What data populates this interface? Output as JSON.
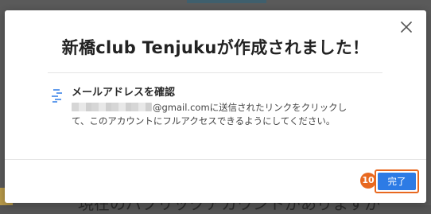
{
  "background": {
    "peek_text": "現在のパブリックアカウントがありますか"
  },
  "modal": {
    "title": "新橋club Tenjukuが作成されました！",
    "close_icon": "close-icon",
    "step": {
      "icon": "steps-icon",
      "heading": "メールアドレスを確認",
      "email_visible_part": "@gmail.com",
      "body_line1_rest": "に送信されたリンクをクリックし",
      "body_line2": "て、このアカウントにフルアクセスできるようにしてください。"
    },
    "done_button_label": "完了",
    "step_marker": "10"
  },
  "colors": {
    "primary_button": "#2d7be5",
    "highlight_marker": "#e8681f"
  }
}
